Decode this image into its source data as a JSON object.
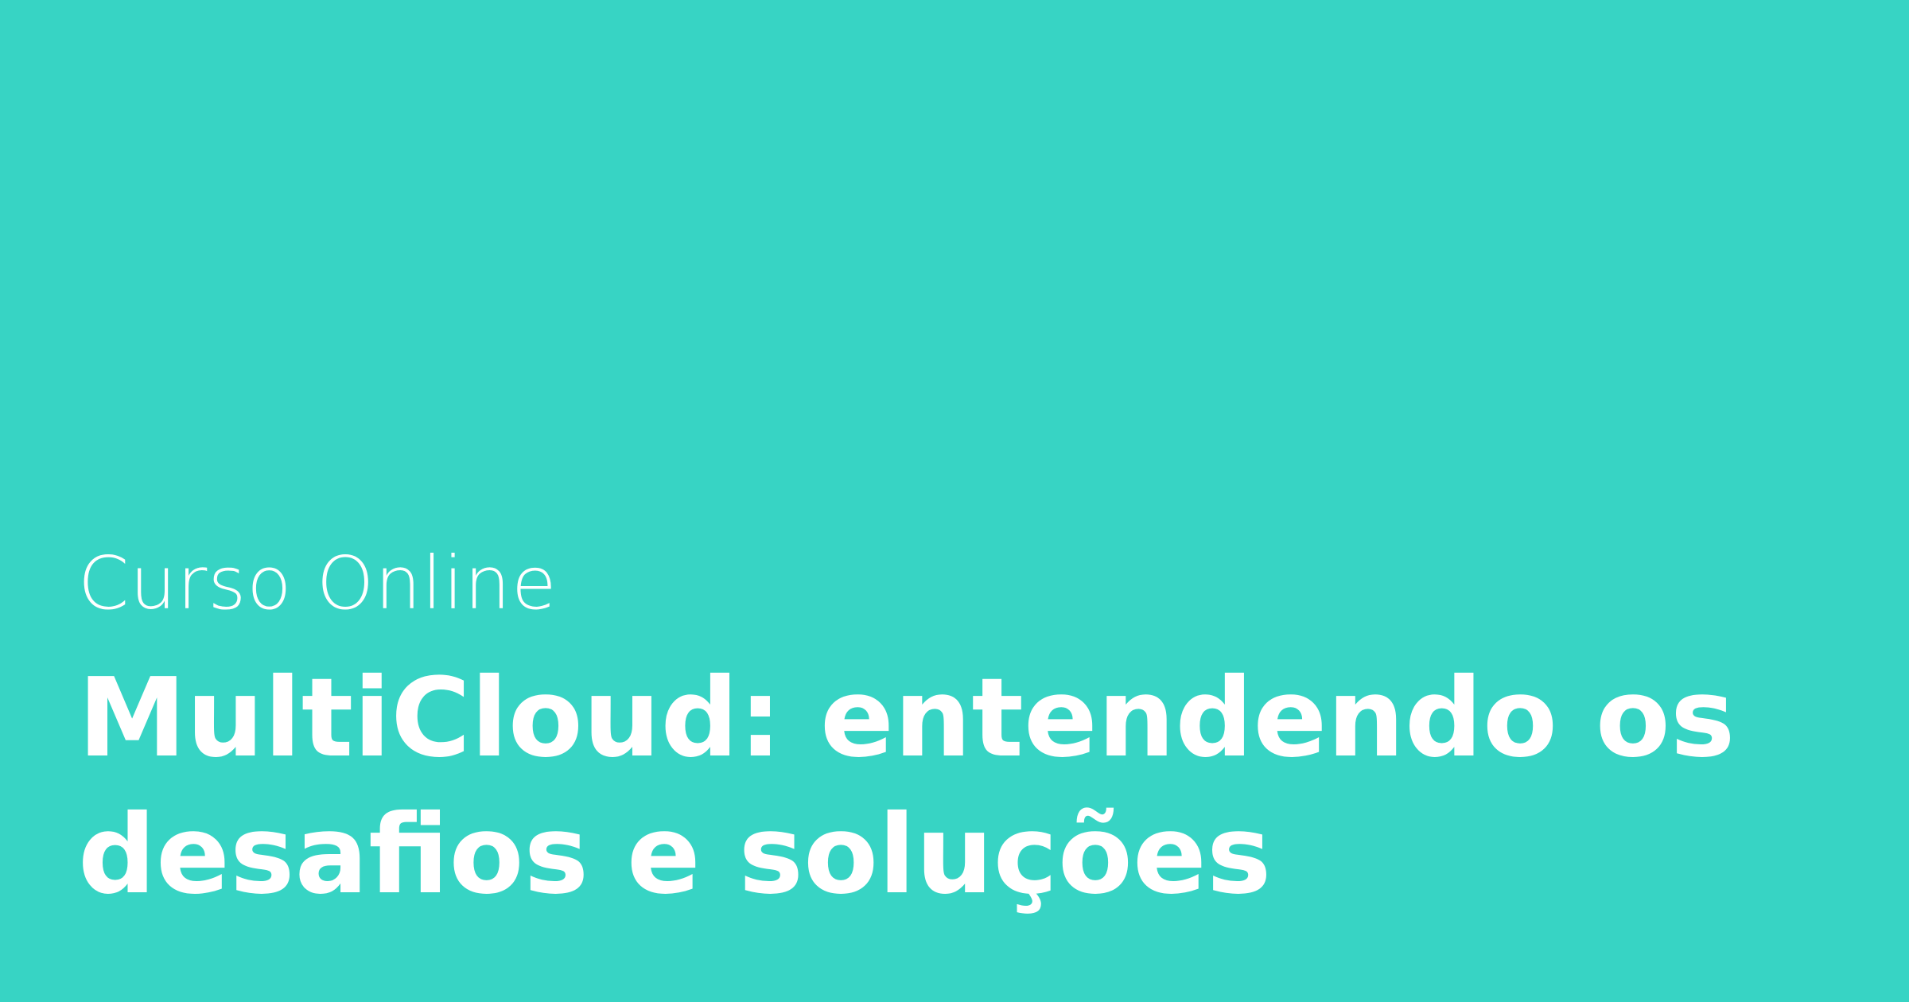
{
  "banner": {
    "background_color": "#37d4c4",
    "text_color": "#ffffff",
    "eyebrow": "Curso Online",
    "title": "MultiCloud: entendendo os desafios e soluções"
  }
}
